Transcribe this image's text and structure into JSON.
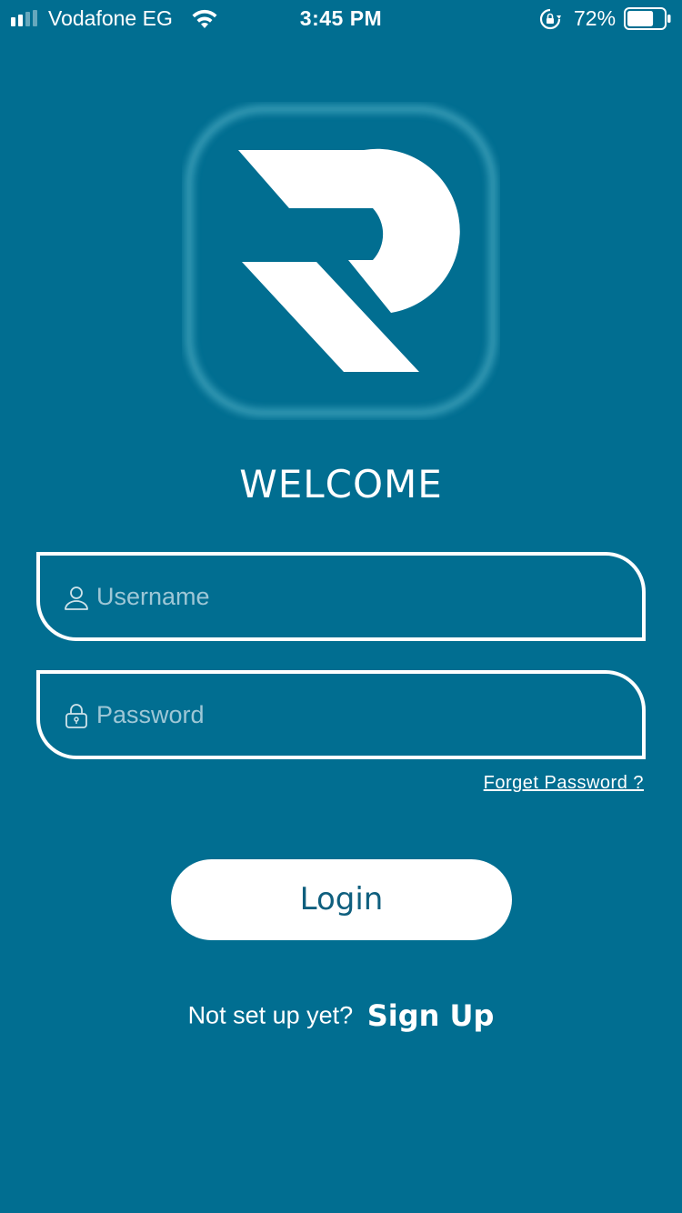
{
  "status_bar": {
    "carrier": "Vodafone EG",
    "time": "3:45 PM",
    "battery_percent": "72%",
    "battery_level": 0.72,
    "signal_bars": 2,
    "icons": [
      "signal-icon",
      "wifi-icon",
      "orientation-lock-icon",
      "battery-icon"
    ]
  },
  "logo": {
    "icon": "r-logo-icon"
  },
  "title": "WELCOME",
  "form": {
    "username_placeholder": "Username",
    "password_placeholder": "Password",
    "username_icon": "user-icon",
    "password_icon": "lock-icon",
    "forgot_label": "Forget Password ?",
    "login_label": "Login"
  },
  "footer": {
    "prompt": "Not set up yet?",
    "signup_label": "Sign Up"
  },
  "colors": {
    "background": "#016e91",
    "button_text": "#0f5f7e",
    "placeholder": "#9ec7d6"
  }
}
